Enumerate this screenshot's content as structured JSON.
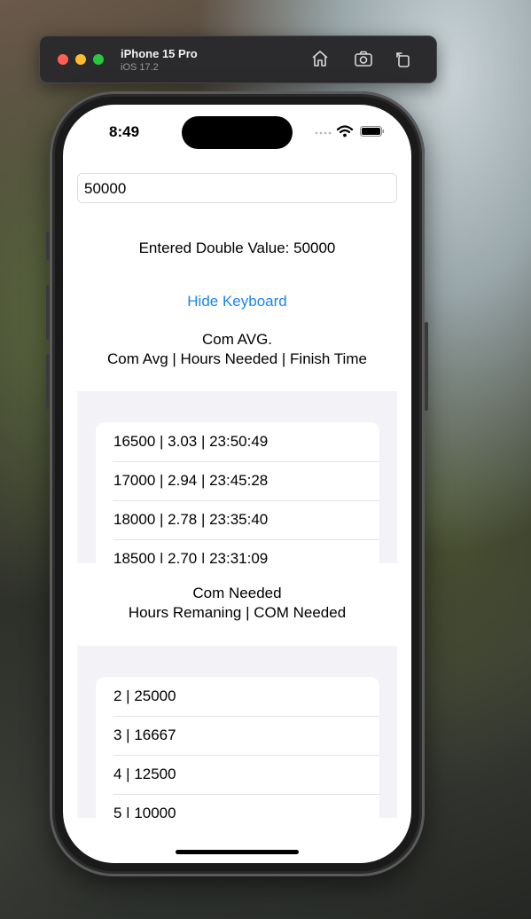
{
  "simulator": {
    "device_name": "iPhone 15 Pro",
    "os_version": "iOS 17.2",
    "buttons": [
      "home-icon",
      "screenshot-icon",
      "rotate-icon"
    ]
  },
  "status_bar": {
    "time": "8:49"
  },
  "input": {
    "value": "50000"
  },
  "entered_label": "Entered Double Value: 50000",
  "hide_keyboard_label": "Hide Keyboard",
  "com_avg": {
    "title": "Com AVG.",
    "header": "Com Avg |  Hours Needed |  Finish Time",
    "rows": [
      "16500 | 3.03 | 23:50:49",
      "17000 | 2.94 | 23:45:28",
      "18000 | 2.78 | 23:35:40",
      "18500 | 2.70 | 23:31:09"
    ]
  },
  "com_needed": {
    "title": "Com Needed",
    "header": "Hours Remaning |   COM Needed",
    "rows": [
      "2 | 25000",
      "3 | 16667",
      "4 | 12500",
      "5 | 10000"
    ]
  },
  "colors": {
    "link": "#1a84f5",
    "list_background": "#f2f2f7"
  }
}
